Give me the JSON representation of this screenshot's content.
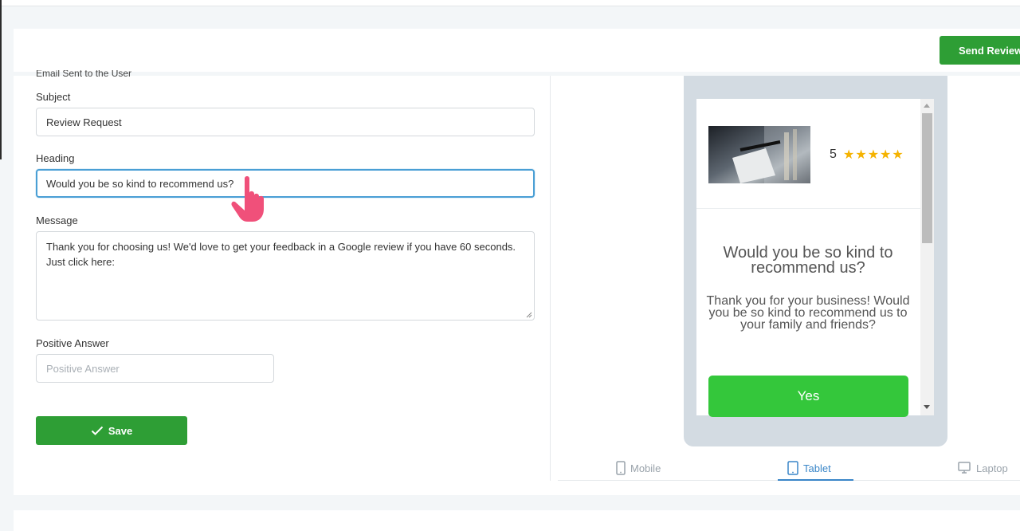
{
  "header": {
    "send_review_label": "Send Review"
  },
  "form": {
    "section_title": "Email Sent to the User",
    "subject": {
      "label": "Subject",
      "value": "Review Request"
    },
    "heading": {
      "label": "Heading",
      "value": "Would you be so kind to recommend us?"
    },
    "message": {
      "label": "Message",
      "value": "Thank you for choosing us! We'd love to get your feedback in a Google review if you have 60 seconds. Just click here:"
    },
    "positive_answer": {
      "label": "Positive Answer",
      "placeholder": "Positive Answer"
    },
    "save_label": "Save"
  },
  "preview": {
    "rating": "5",
    "stars": "★★★★★",
    "heading": "Would you be so kind to recommend us?",
    "message": "Thank you for your business! Would you be so kind to recommend us to your family and friends?",
    "yes_label": "Yes"
  },
  "device_tabs": [
    {
      "label": "Mobile"
    },
    {
      "label": "Tablet"
    },
    {
      "label": "Laptop"
    }
  ],
  "colors": {
    "primary_green": "#2e9e35",
    "yes_green": "#34c73b",
    "active_tab": "#3a86c8",
    "star": "#f5b301"
  }
}
